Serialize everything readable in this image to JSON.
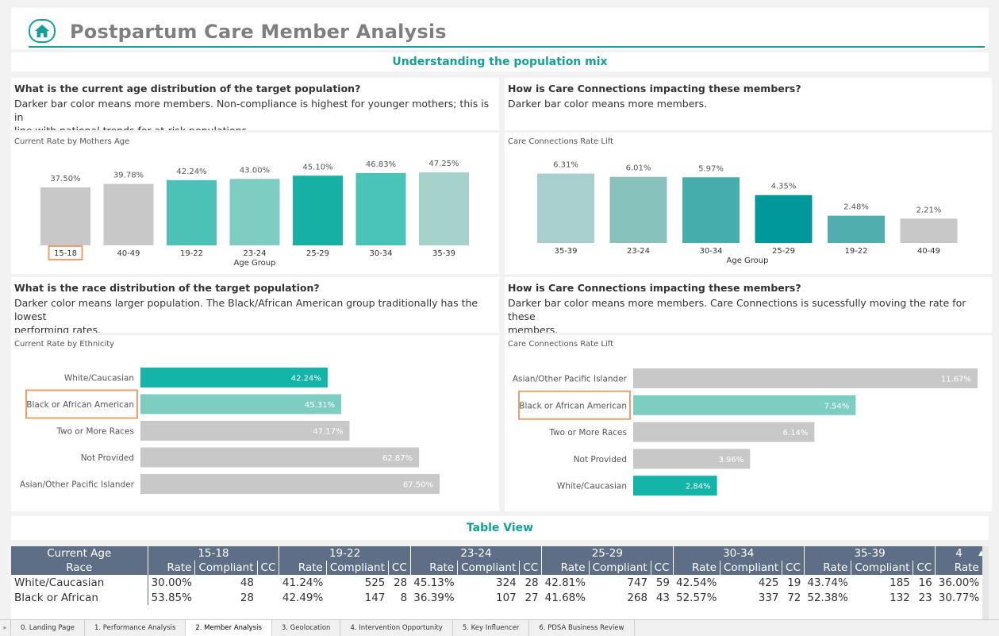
{
  "header": {
    "title": "Postpartum Care Member Analysis"
  },
  "section1": {
    "title": "Understanding the population mix"
  },
  "q_age": {
    "title": "What is the current age distribution of the target population?",
    "desc1": "Darker bar color means more members.  Non-compliance is highest for younger mothers; this is in",
    "desc2": "line with national trends for at-risk populations."
  },
  "q_cc_age": {
    "title": "How is Care Connections impacting these members?",
    "desc1": "Darker bar color means more members."
  },
  "q_race": {
    "title": "What is the race distribution of the target population?",
    "desc1": "Darker color means larger population. The Black/African American group traditionally has the lowest",
    "desc2": "performing rates."
  },
  "q_cc_race": {
    "title": "How is Care Connections impacting these members?",
    "desc1": "Darker bar color means more members.  Care Connections is sucessfully moving the rate for these",
    "desc2": "members."
  },
  "section2": {
    "title": "Table View"
  },
  "chart_data": [
    {
      "type": "bar",
      "title": "Current Rate by Mothers Age",
      "xlabel": "Age Group",
      "categories": [
        "15-18",
        "40-49",
        "19-22",
        "23-24",
        "25-29",
        "30-34",
        "35-39"
      ],
      "values": [
        37.5,
        39.78,
        42.24,
        43.0,
        45.1,
        46.83,
        47.25
      ],
      "labels": [
        "37.50%",
        "39.78%",
        "42.24%",
        "43.00%",
        "45.10%",
        "46.83%",
        "47.25%"
      ],
      "colors": [
        "#c8c8c8",
        "#c8c8c8",
        "#4cc2b6",
        "#7ecdc3",
        "#14b1a4",
        "#4ac3b8",
        "#a6d2cc"
      ],
      "highlight": "15-18"
    },
    {
      "type": "bar",
      "title": "Care Connections Rate Lift",
      "xlabel": "Age Group",
      "categories": [
        "35-39",
        "23-24",
        "30-34",
        "25-29",
        "19-22",
        "40-49"
      ],
      "values": [
        6.31,
        6.01,
        5.97,
        4.35,
        2.48,
        2.21
      ],
      "labels": [
        "6.31%",
        "6.01%",
        "5.97%",
        "4.35%",
        "2.48%",
        "2.21%"
      ],
      "colors": [
        "#a8cfcd",
        "#87c2bd",
        "#45adab",
        "#00989a",
        "#50aeae",
        "#c8c8c8"
      ]
    },
    {
      "type": "bar",
      "orientation": "horizontal",
      "title": "Current Rate by Ethnicity",
      "categories": [
        "White/Caucasian",
        "Black or African American",
        "Two or More Races",
        "Not Provided",
        "Asian/Other Pacific Islander"
      ],
      "values": [
        42.24,
        45.31,
        47.17,
        62.87,
        67.5
      ],
      "labels": [
        "42.24%",
        "45.31%",
        "47.17%",
        "62.87%",
        "67.50%"
      ],
      "colors": [
        "#12b5a8",
        "#7ecdc3",
        "#c8c8c8",
        "#c8c8c8",
        "#c8c8c8"
      ],
      "highlight": "Black or African American"
    },
    {
      "type": "bar",
      "orientation": "horizontal",
      "title": "Care Connections Rate Lift",
      "categories": [
        "Asian/Other Pacific Islander",
        "Black or African American",
        "Two or More Races",
        "Not Provided",
        "White/Caucasian"
      ],
      "values": [
        11.67,
        7.54,
        6.14,
        3.96,
        2.84
      ],
      "labels": [
        "11.67%",
        "7.54%",
        "6.14%",
        "3.96%",
        "2.84%"
      ],
      "colors": [
        "#c8c8c8",
        "#7ecdc3",
        "#c8c8c8",
        "#c8c8c8",
        "#12b5a8"
      ],
      "highlight": "Black or African American"
    }
  ],
  "table": {
    "corner_top": "Current Age",
    "corner_bottom": "Race",
    "age_groups": [
      "15-18",
      "19-22",
      "23-24",
      "25-29",
      "30-34",
      "35-39",
      "4"
    ],
    "subheaders": [
      "Rate",
      "Compliant",
      "CC"
    ],
    "rows": [
      {
        "race": "White/Caucasian",
        "cells": [
          "30.00%",
          "48",
          "",
          "41.24%",
          "525",
          "28",
          "45.13%",
          "324",
          "28",
          "42.81%",
          "747",
          "59",
          "42.54%",
          "425",
          "19",
          "43.74%",
          "185",
          "16",
          "36.00%"
        ]
      },
      {
        "race": "Black or African",
        "cells": [
          "53.85%",
          "28",
          "",
          "42.49%",
          "147",
          "8",
          "36.39%",
          "107",
          "27",
          "41.68%",
          "268",
          "43",
          "52.57%",
          "337",
          "72",
          "52.38%",
          "132",
          "23",
          "30.77%"
        ]
      }
    ]
  },
  "tabs": [
    "0. Landing Page",
    "1. Performance Analysis",
    "2. Member Analysis",
    "3. Geolocation",
    "4. Intervention Opportunity",
    "5. Key Influencer",
    "6. PDSA Business Review"
  ],
  "active_tab": "2. Member Analysis"
}
